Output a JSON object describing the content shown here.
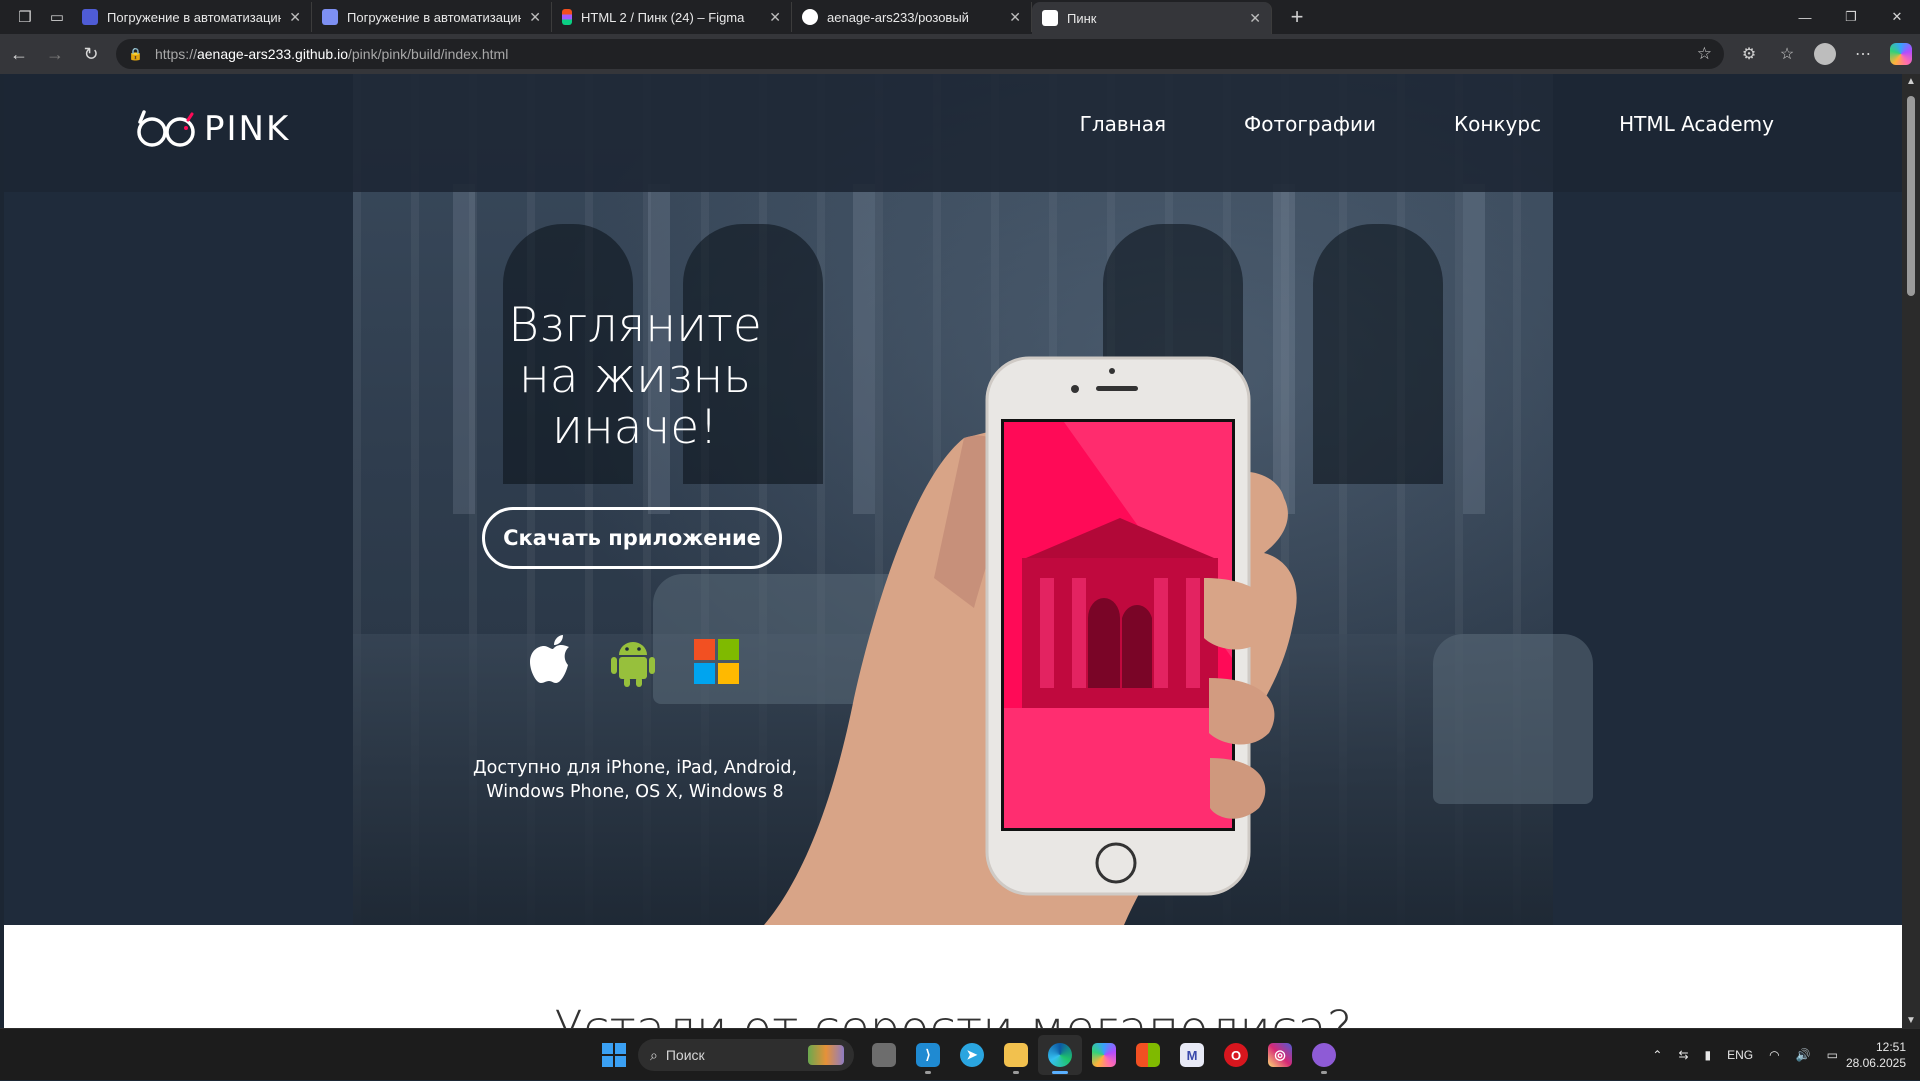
{
  "browser": {
    "tabs": [
      {
        "title": "Погружение в автоматизацию -",
        "favicon_color": "#6b7cff",
        "active": false
      },
      {
        "title": "Погружение в автоматизацию -",
        "favicon_color": "#8aa0ff",
        "active": false
      },
      {
        "title": "HTML 2 / Пинк (24) – Figma",
        "favicon_color": "#f24e1e",
        "active": false
      },
      {
        "title": "aenage-ars233/розовый",
        "favicon_color": "#ffffff",
        "active": false
      },
      {
        "title": "Пинк",
        "favicon_color": "#ffffff",
        "active": true
      }
    ],
    "new_tab_label": "+",
    "url": {
      "scheme": "https://",
      "host": "aenage-ars233.github.io",
      "path": "/pink/pink/build/index.html"
    }
  },
  "site": {
    "logo_text": "PINK",
    "nav": [
      "Главная",
      "Фотографии",
      "Конкурс",
      "HTML Academy"
    ],
    "headline": [
      "Взгляните",
      "на жизнь",
      "иначе!"
    ],
    "cta_label": "Скачать приложение",
    "platform_icons": [
      "apple-icon",
      "android-icon",
      "windows-icon"
    ],
    "availability": [
      "Доступно для iPhone, iPad, Android,",
      "Windows Phone, OS X, Windows 8"
    ],
    "section2_title": "Устали от серости мегаполиса?",
    "accent_color": "#ff0a57"
  },
  "taskbar": {
    "search_placeholder": "Поиск",
    "apps": [
      "file-explorer-icon",
      "vscode-icon",
      "telegram-icon",
      "folder-icon",
      "edge-icon",
      "copilot-icon",
      "store-icon",
      "mail-icon",
      "opera-icon",
      "instagram-icon",
      "github-icon"
    ],
    "language": "ENG",
    "time": "12:51",
    "date": "28.06.2025"
  }
}
